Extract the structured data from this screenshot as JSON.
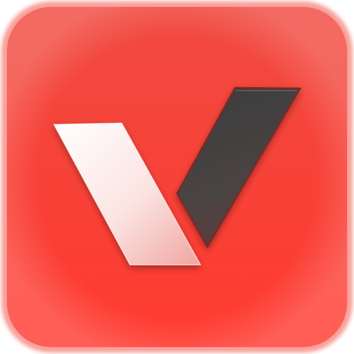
{
  "app_icon": {
    "name": "app-icon",
    "shape": "rounded-square",
    "colors": {
      "background_top": "#F04A40",
      "background_bottom": "#FF3A30",
      "rim": "#F8A09A",
      "left_stroke_top": "#FFFFFF",
      "left_stroke_bottom": "#F0A5A0",
      "right_stroke_top": "#3C3C3C",
      "right_stroke_bottom": "#5A3D3B",
      "right_stroke_edge": "#7A2A26"
    },
    "glyph": "v-check-mark"
  }
}
